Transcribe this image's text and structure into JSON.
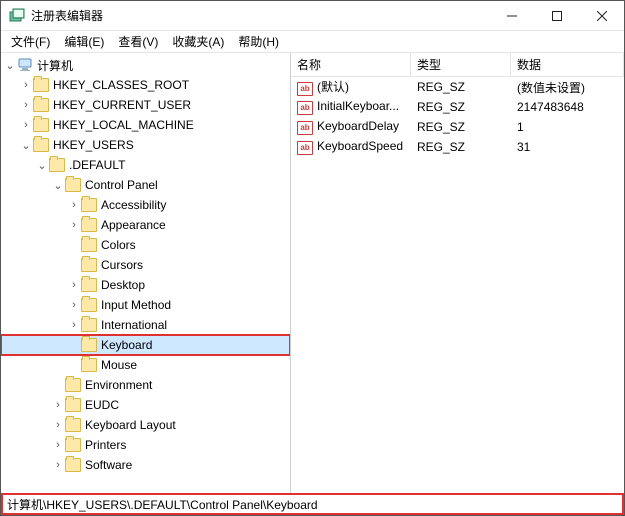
{
  "window": {
    "title": "注册表编辑器"
  },
  "menu": {
    "file": "文件(F)",
    "edit": "编辑(E)",
    "view": "查看(V)",
    "favorites": "收藏夹(A)",
    "help": "帮助(H)"
  },
  "tree": {
    "root": "计算机",
    "hkcr": "HKEY_CLASSES_ROOT",
    "hkcu": "HKEY_CURRENT_USER",
    "hklm": "HKEY_LOCAL_MACHINE",
    "hku": "HKEY_USERS",
    "default": ".DEFAULT",
    "control_panel": "Control Panel",
    "accessibility": "Accessibility",
    "appearance": "Appearance",
    "colors": "Colors",
    "cursors": "Cursors",
    "desktop": "Desktop",
    "input_method": "Input Method",
    "international": "International",
    "keyboard": "Keyboard",
    "mouse": "Mouse",
    "environment": "Environment",
    "eudc": "EUDC",
    "keyboard_layout": "Keyboard Layout",
    "printers": "Printers",
    "software": "Software"
  },
  "list": {
    "headers": {
      "name": "名称",
      "type": "类型",
      "data": "数据"
    },
    "rows": [
      {
        "name": "(默认)",
        "type": "REG_SZ",
        "data": "(数值未设置)"
      },
      {
        "name": "InitialKeyboar...",
        "type": "REG_SZ",
        "data": "2147483648"
      },
      {
        "name": "KeyboardDelay",
        "type": "REG_SZ",
        "data": "1"
      },
      {
        "name": "KeyboardSpeed",
        "type": "REG_SZ",
        "data": "31"
      }
    ]
  },
  "statusbar": {
    "path": "计算机\\HKEY_USERS\\.DEFAULT\\Control Panel\\Keyboard"
  }
}
